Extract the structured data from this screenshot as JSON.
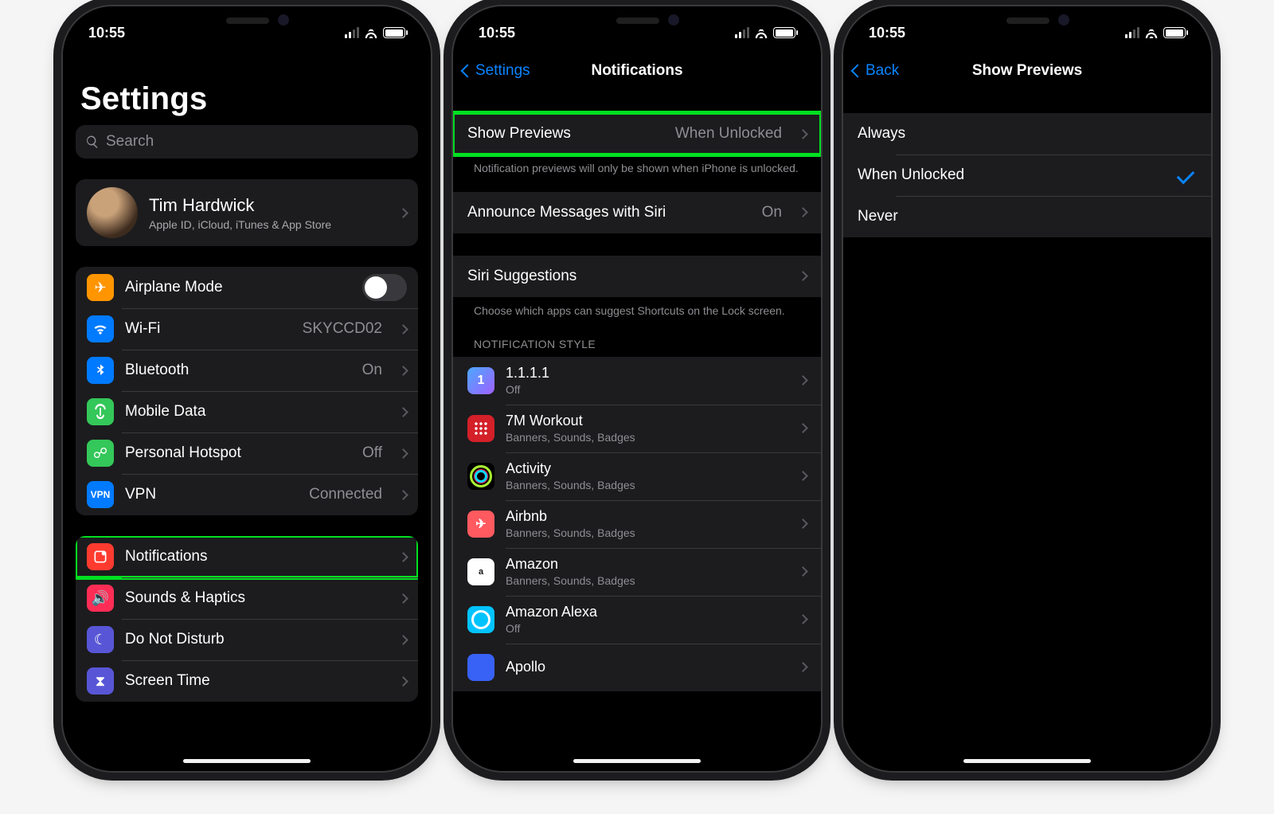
{
  "status": {
    "time": "10:55"
  },
  "screen1": {
    "title": "Settings",
    "search_placeholder": "Search",
    "profile": {
      "name": "Tim Hardwick",
      "desc": "Apple ID, iCloud, iTunes & App Store"
    },
    "rows_net": [
      {
        "icon": "airplane",
        "label": "Airplane Mode",
        "value": "",
        "kind": "toggle"
      },
      {
        "icon": "wifi",
        "label": "Wi-Fi",
        "value": "SKYCCD02",
        "kind": "link"
      },
      {
        "icon": "bt",
        "label": "Bluetooth",
        "value": "On",
        "kind": "link"
      },
      {
        "icon": "cell",
        "label": "Mobile Data",
        "value": "",
        "kind": "link"
      },
      {
        "icon": "hotspot",
        "label": "Personal Hotspot",
        "value": "Off",
        "kind": "link"
      },
      {
        "icon": "vpn",
        "label": "VPN",
        "value": "Connected",
        "kind": "link"
      }
    ],
    "rows_sys": [
      {
        "icon": "notif",
        "label": "Notifications",
        "highlight": true
      },
      {
        "icon": "sound",
        "label": "Sounds & Haptics"
      },
      {
        "icon": "dnd",
        "label": "Do Not Disturb"
      },
      {
        "icon": "screen",
        "label": "Screen Time"
      }
    ]
  },
  "screen2": {
    "back": "Settings",
    "title": "Notifications",
    "show_previews": {
      "label": "Show Previews",
      "value": "When Unlocked"
    },
    "show_previews_note": "Notification previews will only be shown when iPhone is unlocked.",
    "announce": {
      "label": "Announce Messages with Siri",
      "value": "On"
    },
    "siri_sugg": {
      "label": "Siri Suggestions"
    },
    "siri_note": "Choose which apps can suggest Shortcuts on the Lock screen.",
    "style_header": "Notification Style",
    "apps": [
      {
        "icon": "1111",
        "name": "1.1.1.1",
        "detail": "Off"
      },
      {
        "icon": "7m",
        "name": "7M Workout",
        "detail": "Banners, Sounds, Badges"
      },
      {
        "icon": "activity",
        "name": "Activity",
        "detail": "Banners, Sounds, Badges"
      },
      {
        "icon": "airbnb",
        "name": "Airbnb",
        "detail": "Banners, Sounds, Badges"
      },
      {
        "icon": "amazon",
        "name": "Amazon",
        "detail": "Banners, Sounds, Badges"
      },
      {
        "icon": "alexa",
        "name": "Amazon Alexa",
        "detail": "Off"
      },
      {
        "icon": "apollo",
        "name": "Apollo",
        "detail": ""
      }
    ]
  },
  "screen3": {
    "back": "Back",
    "title": "Show Previews",
    "options": [
      {
        "label": "Always",
        "selected": false
      },
      {
        "label": "When Unlocked",
        "selected": true
      },
      {
        "label": "Never",
        "selected": false
      }
    ]
  }
}
